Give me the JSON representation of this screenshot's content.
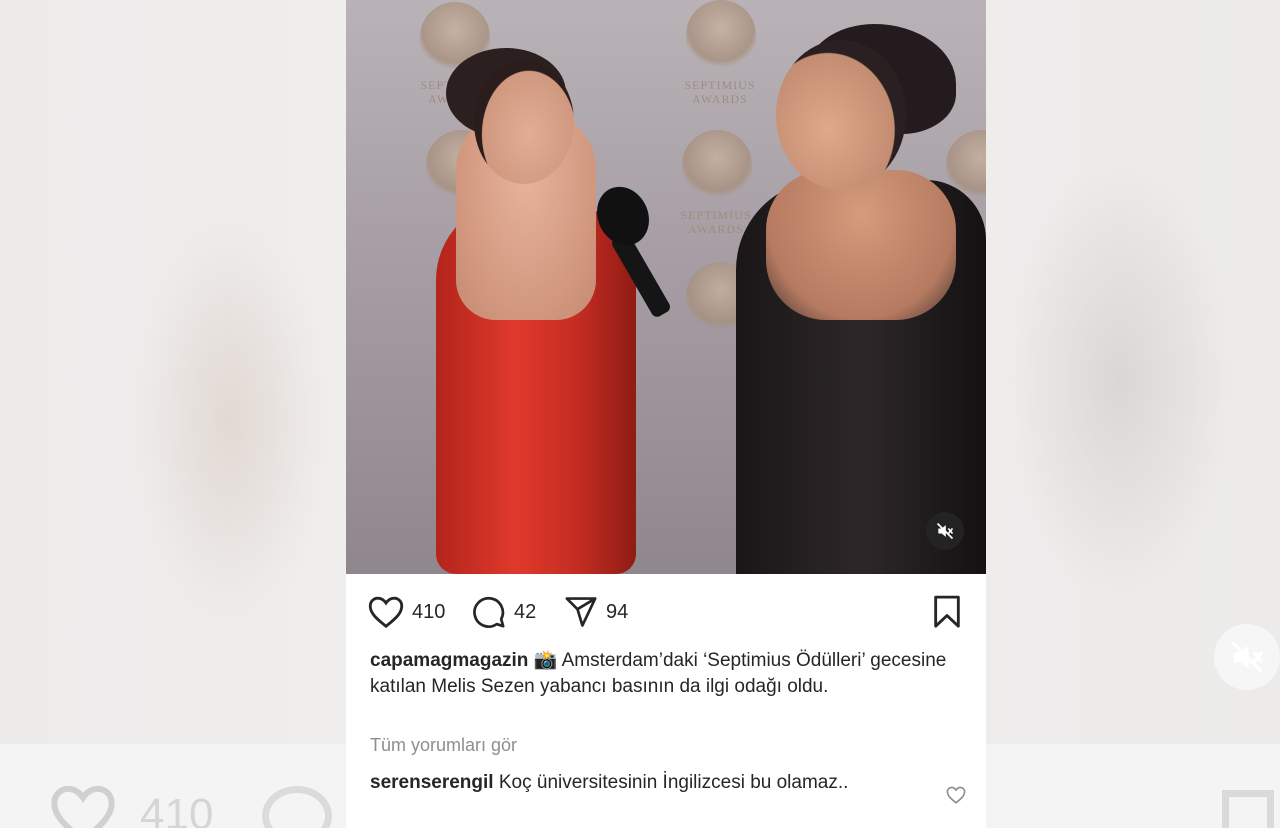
{
  "post": {
    "likes": "410",
    "comments": "42",
    "shares": "94",
    "caption_user": "capamagmagazin",
    "caption_emoji": "📸",
    "caption_text": "Amsterdam’daki ‘Septimius Ödülleri’ gecesine katılan Melis Sezen yabancı basının da ilgi odağı oldu.",
    "view_all_comments": "Tüm yorumları gör",
    "comment_user": "serenserengil",
    "comment_text": "Koç üniversitesinin İngilizcesi bu olamaz..",
    "backdrop_text_1": "SEPTIMIUS",
    "backdrop_text_2": "AWARDS",
    "background_likes_ghost": "410"
  },
  "icons": {
    "like": "heart-icon",
    "comment": "comment-bubble-icon",
    "share": "paper-plane-icon",
    "save": "bookmark-icon",
    "mute": "speaker-muted-icon",
    "comment_like": "small-heart-icon"
  },
  "colors": {
    "text": "#262626",
    "muted": "#8e8e8e",
    "dress_red": "#d8352a"
  }
}
